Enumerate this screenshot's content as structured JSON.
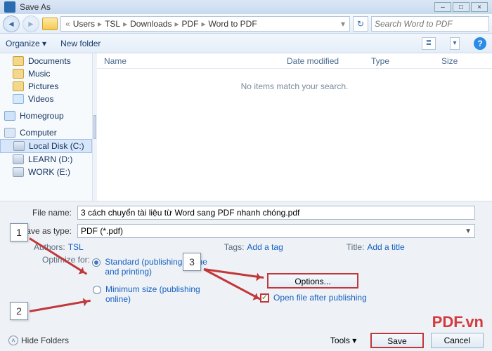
{
  "window": {
    "title": "Save As",
    "min": "–",
    "max": "□",
    "close": "×"
  },
  "breadcrumbs": {
    "sep_first": "«",
    "c1": "Users",
    "c2": "TSL",
    "c3": "Downloads",
    "c4": "PDF",
    "c5": "Word to PDF"
  },
  "search": {
    "placeholder": "Search Word to PDF"
  },
  "toolbar": {
    "organize": "Organize ▾",
    "newfolder": "New folder",
    "view_dd": "▾"
  },
  "sidebar": {
    "documents": "Documents",
    "music": "Music",
    "pictures": "Pictures",
    "videos": "Videos",
    "homegroup": "Homegroup",
    "computer": "Computer",
    "localdisk": "Local Disk (C:)",
    "learn": "LEARN (D:)",
    "work": "WORK (E:)"
  },
  "columns": {
    "name": "Name",
    "date": "Date modified",
    "type": "Type",
    "size": "Size"
  },
  "pane": {
    "empty": "No items match your search."
  },
  "form": {
    "filename_lbl": "File name:",
    "filename_val": "3 cách chuyển tài liệu từ Word sang PDF nhanh chóng.pdf",
    "type_lbl": "Save as type:",
    "type_val": "PDF (*.pdf)",
    "authors_k": "Authors:",
    "authors_v": "TSL",
    "tags_k": "Tags:",
    "tags_v": "Add a tag",
    "title_k": "Title:",
    "title_v": "Add a title",
    "optimize_lbl": "Optimize for:",
    "opt_standard": "Standard (publishing online and printing)",
    "opt_minimum": "Minimum size (publishing online)",
    "options_btn": "Options...",
    "openafter": "Open file after publishing"
  },
  "footer": {
    "hidefolders": "Hide Folders",
    "tools": "Tools  ▾",
    "save": "Save",
    "cancel": "Cancel"
  },
  "callouts": {
    "c1": "1",
    "c2": "2",
    "c3": "3"
  },
  "watermark": "PDF.vn"
}
